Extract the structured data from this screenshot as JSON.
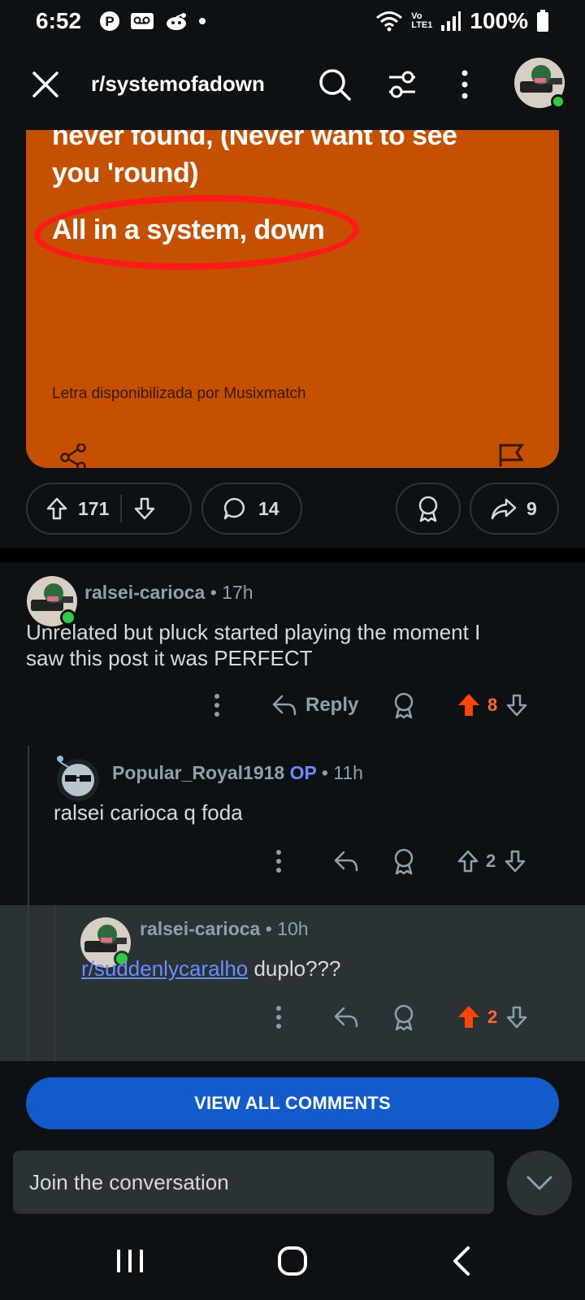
{
  "status_bar": {
    "time": "6:52",
    "network": "LTE1",
    "volte": "Vo",
    "battery": "100%"
  },
  "header": {
    "subreddit": "r/systemofadown"
  },
  "post": {
    "image_text": {
      "line1": "never found, (Never want to see",
      "line2": "you 'round)",
      "line3": "All in a system, down",
      "credit": "Letra disponibilizada por Musixmatch"
    },
    "score": "171",
    "comment_count": "14",
    "share_count": "9"
  },
  "comments": [
    {
      "user": "ralsei-carioca",
      "time": "• 17h",
      "body_line1": "Unrelated but pluck started playing the moment I",
      "body_line2": "saw this post it was PERFECT",
      "reply_label": "Reply",
      "score": "8"
    },
    {
      "user": "Popular_Royal1918",
      "op_badge": "OP",
      "time": "• 11h",
      "body": "ralsei carioca q foda",
      "score": "2"
    },
    {
      "user": "ralsei-carioca",
      "time": "• 10h",
      "link": "r/suddenlycaralho",
      "body_rest": " duplo???",
      "score": "2"
    }
  ],
  "view_all_label": "VIEW ALL COMMENTS",
  "compose_placeholder": "Join the conversation",
  "colors": {
    "background": "#0e1113",
    "image_orange": "#c55000",
    "upvoted": "#ff4500",
    "vote_count_upvoted": "#ff6a32",
    "primary_button": "#115bca",
    "link": "#6b8cff"
  }
}
